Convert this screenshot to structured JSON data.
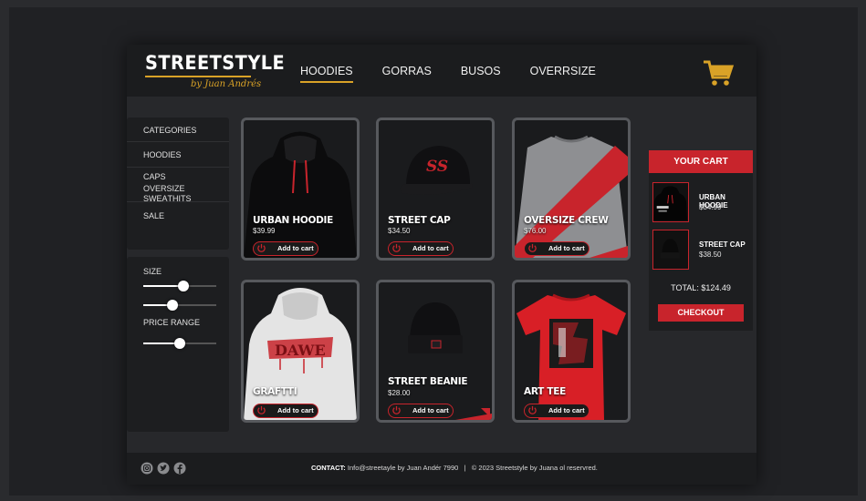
{
  "brand": {
    "name": "STREETSTYLE",
    "tagline": "by Juan Andrés",
    "accent": "#d9a227",
    "red": "#c8242c"
  },
  "nav": [
    "HOODIES",
    "GORRAS",
    "BUSOS",
    "OVERRSIZE"
  ],
  "sidebar": {
    "categories": [
      "CATEGORIES",
      "HOODIES",
      "CAPS",
      "OVERSIZE SWEAΤHITS",
      "SALE"
    ],
    "filters": {
      "size_label": "SIZE",
      "price_label": "PRICE RANGE",
      "size_value": 0.55,
      "size_value2": 0.4,
      "price_value": 0.5
    }
  },
  "products": [
    {
      "name": "URBAN HOODIE",
      "price": "$39.99",
      "button": "Add to cart"
    },
    {
      "name": "STREET CAP",
      "price": "$34.50",
      "button": "Add to cart"
    },
    {
      "name": "OVERSIZE CREW",
      "price": "$76.00",
      "button": "Add to cart"
    },
    {
      "name": "GRAFTTI",
      "price": "",
      "button": "Add to cart"
    },
    {
      "name": "STREET BEANIE",
      "price": "$28.00",
      "button": "Add to cart"
    },
    {
      "name": "ART TEE",
      "price": "",
      "button": "Add to cart"
    }
  ],
  "cart": {
    "title": "YOUR CART",
    "items": [
      {
        "name": "URBAN HOODIE",
        "price": "$34.99"
      },
      {
        "name": "STREET CAP",
        "price": "$38.50"
      }
    ],
    "total": "TOTAL: $124.49",
    "checkout": "CHECKOUT"
  },
  "footer": {
    "contact_label": "CONTACT:",
    "contact_text": " Info@streetayle by Juan Andér 7990",
    "separator": "|",
    "copyright": "© 2023 Streetstyle by Juana ol reservred."
  },
  "icons": [
    "cart-icon",
    "instagram-icon",
    "twitter-icon",
    "facebook-icon",
    "power-icon"
  ]
}
